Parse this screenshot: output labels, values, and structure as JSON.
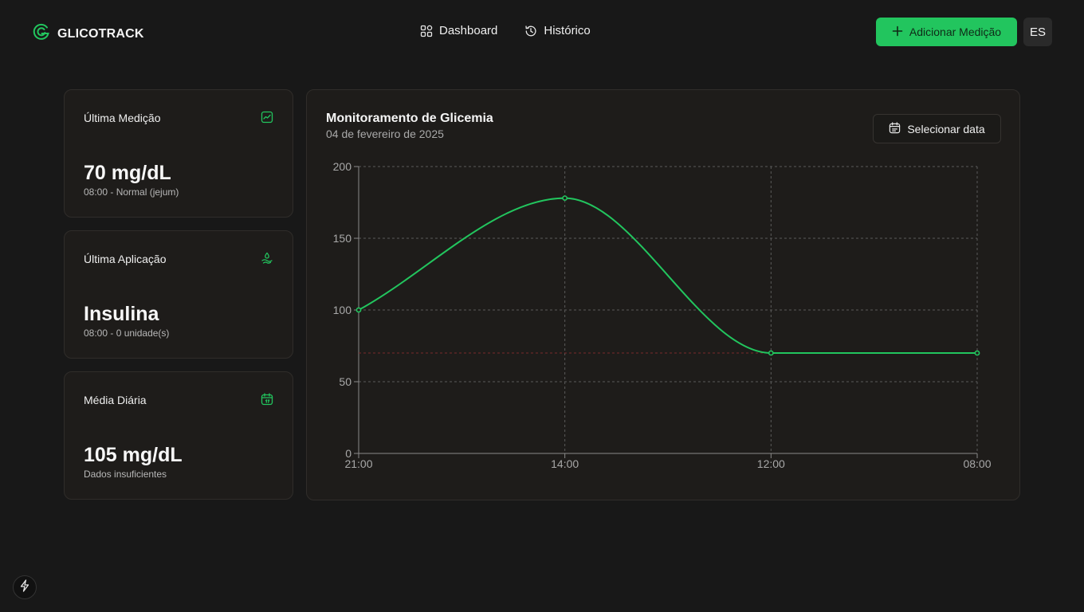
{
  "app": {
    "brand": "GLICOTRACK",
    "accent_color": "#22c55e"
  },
  "nav": {
    "items": [
      {
        "label": "Dashboard",
        "icon": "grid-icon"
      },
      {
        "label": "Histórico",
        "icon": "history-icon"
      }
    ]
  },
  "header": {
    "add_button_label": "Adicionar Medição",
    "language_label": "ES"
  },
  "stats": {
    "last_measurement": {
      "title": "Última Medição",
      "value": "70 mg/dL",
      "detail": "08:00 - Normal (jejum)",
      "icon": "trend-chart-icon"
    },
    "last_application": {
      "title": "Última Aplicação",
      "value": "Insulina",
      "detail": "08:00 - 0 unidade(s)",
      "icon": "syringe-drop-icon"
    },
    "daily_average": {
      "title": "Média Diária",
      "value": "105 mg/dL",
      "detail": "Dados insuficientes",
      "icon": "calendar-icon"
    }
  },
  "chart_panel": {
    "title": "Monitoramento de Glicemia",
    "subtitle": "04 de fevereiro de 2025",
    "date_button_label": "Selecionar data"
  },
  "chart_data": {
    "type": "line",
    "x": [
      "21:00",
      "14:00",
      "12:00",
      "08:00"
    ],
    "series": [
      {
        "values": [
          100,
          178,
          70,
          70
        ],
        "color": "#22c55e"
      }
    ],
    "reference_line": {
      "value": 70,
      "color": "#7a2a2a"
    },
    "ylim": [
      0,
      200
    ],
    "yticks": [
      0,
      50,
      100,
      150,
      200
    ],
    "grid": true,
    "xlabel": "",
    "ylabel": ""
  }
}
